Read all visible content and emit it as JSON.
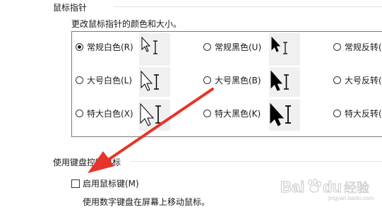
{
  "pointer_section": {
    "title": "鼠标指针",
    "description": "更改鼠标指针的颜色和大小。",
    "options": [
      {
        "label": "常规白色(R)",
        "selected": true,
        "color": "white",
        "size": "normal"
      },
      {
        "label": "常规黑色(U)",
        "selected": false,
        "color": "black",
        "size": "normal"
      },
      {
        "label": "常规反转(",
        "selected": false,
        "color": "invert",
        "size": "normal"
      },
      {
        "label": "大号白色(L)",
        "selected": false,
        "color": "white",
        "size": "large"
      },
      {
        "label": "大号黑色(B)",
        "selected": false,
        "color": "black",
        "size": "large"
      },
      {
        "label": "大号反转(",
        "selected": false,
        "color": "invert",
        "size": "large"
      },
      {
        "label": "特大白色(X)",
        "selected": false,
        "color": "white",
        "size": "xlarge"
      },
      {
        "label": "特大黑色(K)",
        "selected": false,
        "color": "black",
        "size": "xlarge"
      },
      {
        "label": "特大反转(",
        "selected": false,
        "color": "invert",
        "size": "xlarge"
      }
    ]
  },
  "keyboard_section": {
    "title": "使用键盘控制鼠标",
    "enable_label": "启用鼠标键(M)",
    "enable_checked": false,
    "description": "使用数字键盘在屏幕上移动鼠标。"
  },
  "annotation": {
    "arrow_color": "#e8332a"
  },
  "watermark": {
    "text": "Bai du 经验",
    "url": "jingyan.baidu.com"
  }
}
